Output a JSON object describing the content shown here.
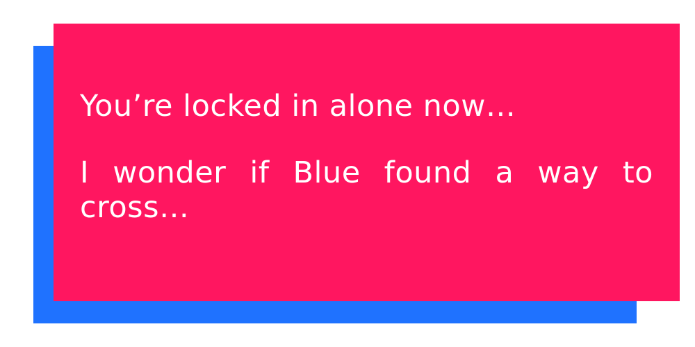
{
  "dialog": {
    "line1": "You’re locked in alone now…",
    "line2": "I wonder if Blue found a way to cross…"
  },
  "colors": {
    "panel": "#ff1660",
    "shadow": "#1f72ff",
    "text": "#ffffff"
  }
}
